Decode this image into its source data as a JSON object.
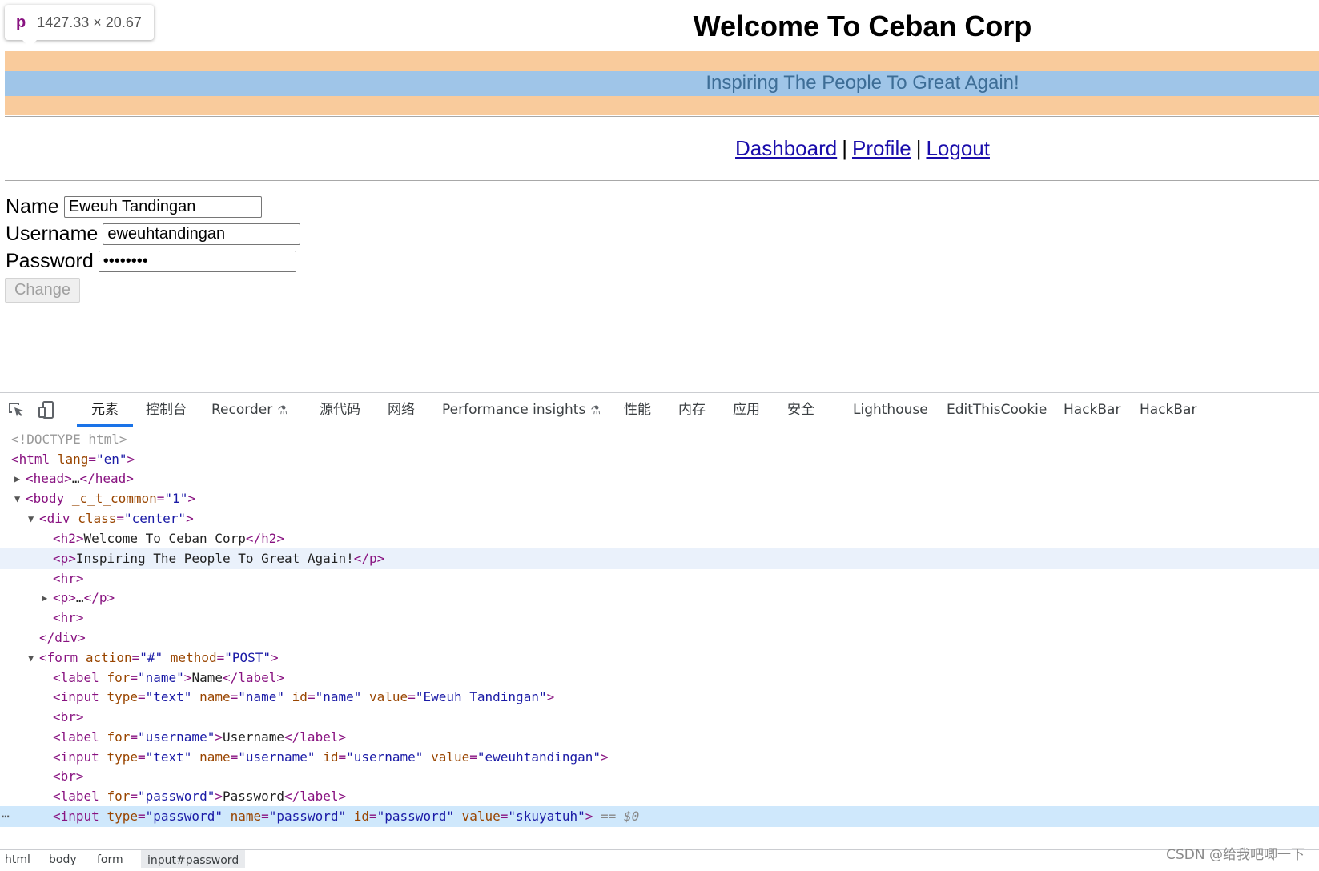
{
  "tooltip": {
    "tag": "p",
    "dims": "1427.33 × 20.67"
  },
  "header": {
    "title": "Welcome To Ceban Corp",
    "tagline": "Inspiring The People To Great Again!"
  },
  "nav": {
    "dashboard": "Dashboard",
    "profile": "Profile",
    "logout": "Logout",
    "separator": "|"
  },
  "form": {
    "name_label": "Name",
    "name_value": "Eweuh Tandingan",
    "username_label": "Username",
    "username_value": "eweuhtandingan",
    "password_label": "Password",
    "password_value": "skuyatuh",
    "change_button": "Change"
  },
  "devtools": {
    "tabs": [
      "元素",
      "控制台",
      "Recorder",
      "源代码",
      "网络",
      "Performance insights",
      "性能",
      "内存",
      "应用",
      "安全",
      "Lighthouse",
      "EditThisCookie",
      "HackBar",
      "HackBar"
    ],
    "active_tab": "元素",
    "breadcrumbs": [
      "html",
      "body",
      "form",
      "input#password"
    ],
    "dom": {
      "doctype": "<!DOCTYPE html>",
      "html": "html",
      "lang_attr": "lang",
      "lang_val": "\"en\"",
      "head": "head",
      "ellipsis": "…",
      "body": "body",
      "body_attr": "_c_t_common",
      "body_val": "\"1\"",
      "div": "div",
      "class_attr": "class",
      "class_val": "\"center\"",
      "h2": "h2",
      "h2_text": "Welcome To Ceban Corp",
      "p": "p",
      "p_text": "Inspiring The People To Great Again!",
      "hr": "hr",
      "form": "form",
      "action_attr": "action",
      "action_val": "\"#\"",
      "method_attr": "method",
      "method_val": "\"POST\"",
      "label": "label",
      "for_attr": "for",
      "input": "input",
      "type_attr": "type",
      "name_attr": "name",
      "id_attr": "id",
      "value_attr": "value",
      "br": "br",
      "name_str": "\"name\"",
      "text_str": "\"text\"",
      "name_text": "Name",
      "name_value_str": "\"Eweuh Tandingan\"",
      "username_str": "\"username\"",
      "username_text": "Username",
      "username_value_str": "\"eweuhtandingan\"",
      "password_str": "\"password\"",
      "password_text": "Password",
      "password_value_str": "\"skuyatuh\"",
      "eq_marker": "== ",
      "dollar": "$0"
    }
  },
  "watermark": "CSDN @给我吧唧一下"
}
